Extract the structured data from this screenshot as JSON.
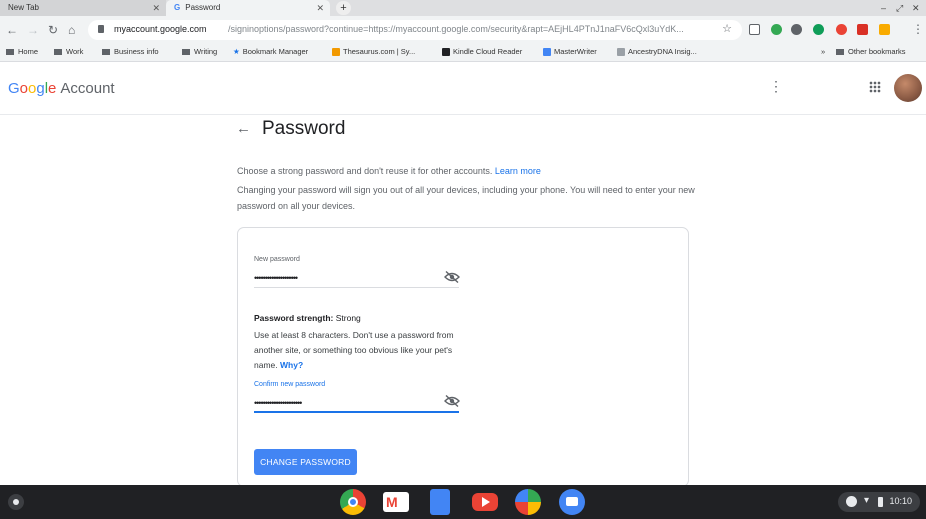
{
  "tabs": [
    {
      "label": "New Tab"
    },
    {
      "label": "Password"
    }
  ],
  "toolbar": {
    "url_domain": "myaccount.google.com",
    "url_path": "/signinoptions/password?continue=https://myaccount.google.com/security&rapt=AEjHL4PTnJ1naFV6cQxl3uYdK..."
  },
  "bookmarks": [
    {
      "label": "Home",
      "icon": "folder-icon"
    },
    {
      "label": "Work",
      "icon": "folder-icon"
    },
    {
      "label": "Business info",
      "icon": "folder-icon"
    },
    {
      "label": "Writing",
      "icon": "folder-icon"
    },
    {
      "label": "Bookmark Manager",
      "icon": "star-icon"
    },
    {
      "label": "Thesaurus.com | Sy...",
      "icon": "thesaurus-icon"
    },
    {
      "label": "Kindle Cloud Reader",
      "icon": "kindle-icon"
    },
    {
      "label": "MasterWriter",
      "icon": "masterwriter-icon"
    },
    {
      "label": "AncestryDNA Insig...",
      "icon": "ancestry-icon"
    },
    {
      "label": "Other bookmarks",
      "icon": "folder-icon"
    }
  ],
  "header": {
    "logo_google": "Google",
    "logo_account": "Account"
  },
  "page": {
    "title": "Password",
    "intro_text": "Choose a strong password and don't reuse it for other accounts.",
    "learn_more": "Learn more",
    "intro_text2": "Changing your password will sign you out of all your devices, including your phone. You will need to enter your new password on all your devices."
  },
  "form": {
    "new_password_label": "New password",
    "new_password_value": "••••••••••••••••••••",
    "strength_label": "Password strength:",
    "strength_value": "Strong",
    "hint_text": "Use at least 8 characters. Don't use a password from another site, or something too obvious like your pet's name.",
    "why_link": "Why?",
    "confirm_label": "Confirm new password",
    "confirm_value": "••••••••••••••••••••••",
    "submit_label": "CHANGE PASSWORD"
  },
  "shelf": {
    "time": "10:10"
  },
  "colors": {
    "accent": "#4285f4",
    "link": "#1a73e8",
    "shelf": "#202124"
  }
}
